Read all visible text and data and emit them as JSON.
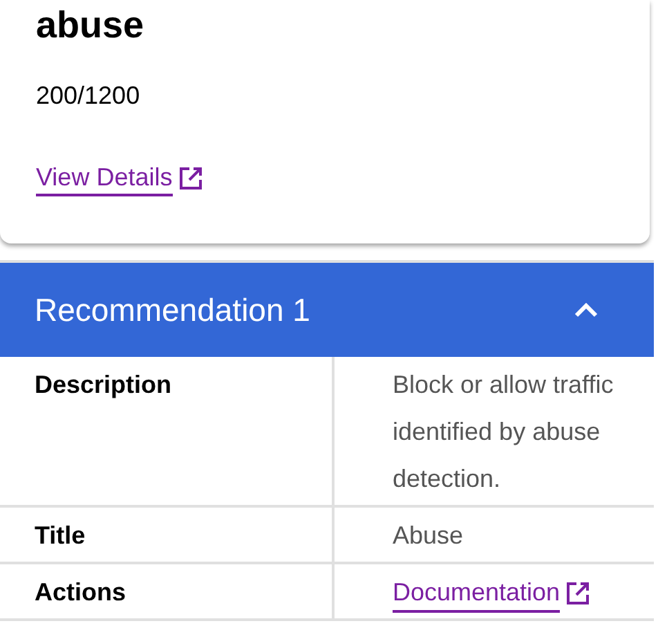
{
  "card": {
    "title": "abuse",
    "count": "200/1200",
    "link": "View Details"
  },
  "panel": {
    "title": "Recommendation 1",
    "expanded": true,
    "rows": [
      {
        "label": "Description",
        "kind": "text",
        "value": "Block or allow traffic identified by abuse detection."
      },
      {
        "label": "Title",
        "kind": "text",
        "value": "Abuse"
      },
      {
        "label": "Actions",
        "kind": "link",
        "value": "Documentation"
      }
    ]
  }
}
